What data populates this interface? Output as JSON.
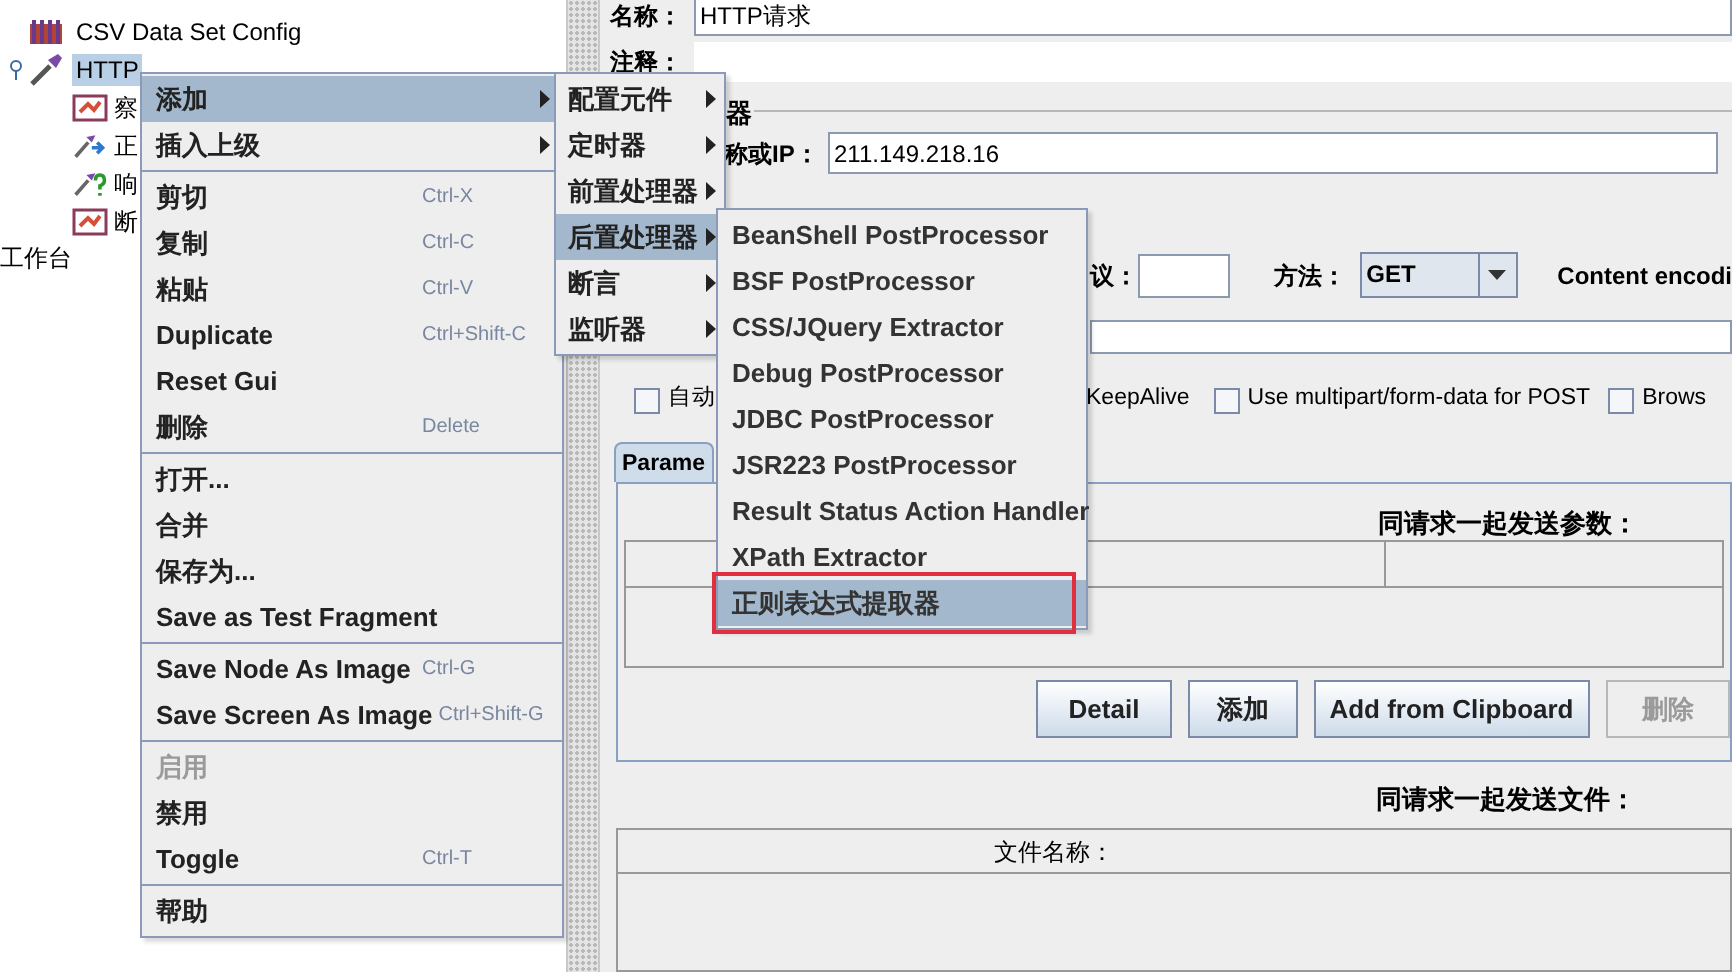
{
  "tree": {
    "items": [
      {
        "label": "CSV Data Set Config",
        "kind": "config",
        "selected": false
      },
      {
        "label": "HTTP",
        "kind": "sampler",
        "selected": true,
        "expanded": true,
        "children": [
          {
            "label": "察",
            "kind": "listener",
            "selected": false
          },
          {
            "label": "正",
            "kind": "extractor",
            "selected": false
          },
          {
            "label": "响",
            "kind": "assertion",
            "selected": false
          },
          {
            "label": "断",
            "kind": "listener",
            "selected": false
          }
        ]
      }
    ],
    "workbench": "工作台"
  },
  "form": {
    "name_label": "名称：",
    "name_value": "HTTP请求",
    "comment_label": "注释：",
    "server_group": "器",
    "host_label": "称或IP：",
    "host_value": "211.149.218.16",
    "protocol_label": "议：",
    "method_label": "方法：",
    "method_value": "GET",
    "encoding_label": "Content encodi",
    "checkboxes": [
      {
        "label": "自动",
        "checked": false
      },
      {
        "label": "KeepAlive"
      },
      {
        "label": "Use multipart/form-data for POST",
        "checked": false
      },
      {
        "label": "Brows",
        "checked": false
      }
    ],
    "tab": {
      "label": "Parame",
      "selected": true
    },
    "params_title": "同请求一起发送参数：",
    "buttons": [
      {
        "label": "Detail",
        "disabled": false
      },
      {
        "label": "添加",
        "disabled": false
      },
      {
        "label": "Add from Clipboard",
        "disabled": false
      },
      {
        "label": "删除",
        "disabled": true
      }
    ],
    "files_title": "同请求一起发送文件：",
    "files_column": "文件名称："
  },
  "context_menu": [
    {
      "kind": "submenu",
      "label": "添加",
      "selected": true
    },
    {
      "kind": "submenu",
      "label": "插入上级",
      "selected": false
    },
    {
      "kind": "separator"
    },
    {
      "kind": "item",
      "label": "剪切",
      "shortcut": "Ctrl-X",
      "disabled": false
    },
    {
      "kind": "item",
      "label": "复制",
      "shortcut": "Ctrl-C",
      "disabled": false
    },
    {
      "kind": "item",
      "label": "粘贴",
      "shortcut": "Ctrl-V",
      "disabled": false
    },
    {
      "kind": "item",
      "label": "Duplicate",
      "shortcut": "Ctrl+Shift-C",
      "disabled": false
    },
    {
      "kind": "item",
      "label": "Reset Gui",
      "disabled": false
    },
    {
      "kind": "item",
      "label": "删除",
      "shortcut": "Delete",
      "disabled": false
    },
    {
      "kind": "separator"
    },
    {
      "kind": "item",
      "label": "打开...",
      "disabled": false
    },
    {
      "kind": "item",
      "label": "合并",
      "disabled": false
    },
    {
      "kind": "item",
      "label": "保存为...",
      "disabled": false
    },
    {
      "kind": "item",
      "label": "Save as Test Fragment",
      "disabled": false
    },
    {
      "kind": "separator"
    },
    {
      "kind": "item",
      "label": "Save Node As Image",
      "shortcut": "Ctrl-G",
      "disabled": false
    },
    {
      "kind": "item",
      "label": "Save Screen As Image",
      "shortcut": "Ctrl+Shift-G",
      "disabled": false
    },
    {
      "kind": "separator"
    },
    {
      "kind": "item",
      "label": "启用",
      "disabled": true
    },
    {
      "kind": "item",
      "label": "禁用",
      "disabled": false
    },
    {
      "kind": "item",
      "label": "Toggle",
      "shortcut": "Ctrl-T",
      "disabled": false
    },
    {
      "kind": "separator"
    },
    {
      "kind": "item",
      "label": "帮助",
      "disabled": false
    }
  ],
  "add_submenu": [
    {
      "label": "配置元件",
      "selected": false
    },
    {
      "label": "定时器",
      "selected": false
    },
    {
      "label": "前置处理器",
      "selected": false
    },
    {
      "label": "后置处理器",
      "selected": true
    },
    {
      "label": "断言",
      "selected": false
    },
    {
      "label": "监听器",
      "selected": false
    }
  ],
  "postprocessor_submenu": [
    {
      "label": "BeanShell PostProcessor",
      "selected": false
    },
    {
      "label": "BSF PostProcessor",
      "selected": false
    },
    {
      "label": "CSS/JQuery Extractor",
      "selected": false
    },
    {
      "label": "Debug PostProcessor",
      "selected": false
    },
    {
      "label": "JDBC PostProcessor",
      "selected": false
    },
    {
      "label": "JSR223 PostProcessor",
      "selected": false
    },
    {
      "label": "Result Status Action Handler",
      "selected": false
    },
    {
      "label": "XPath Extractor",
      "selected": false
    },
    {
      "label": "正则表达式提取器",
      "selected": true,
      "highlighted": true
    }
  ]
}
